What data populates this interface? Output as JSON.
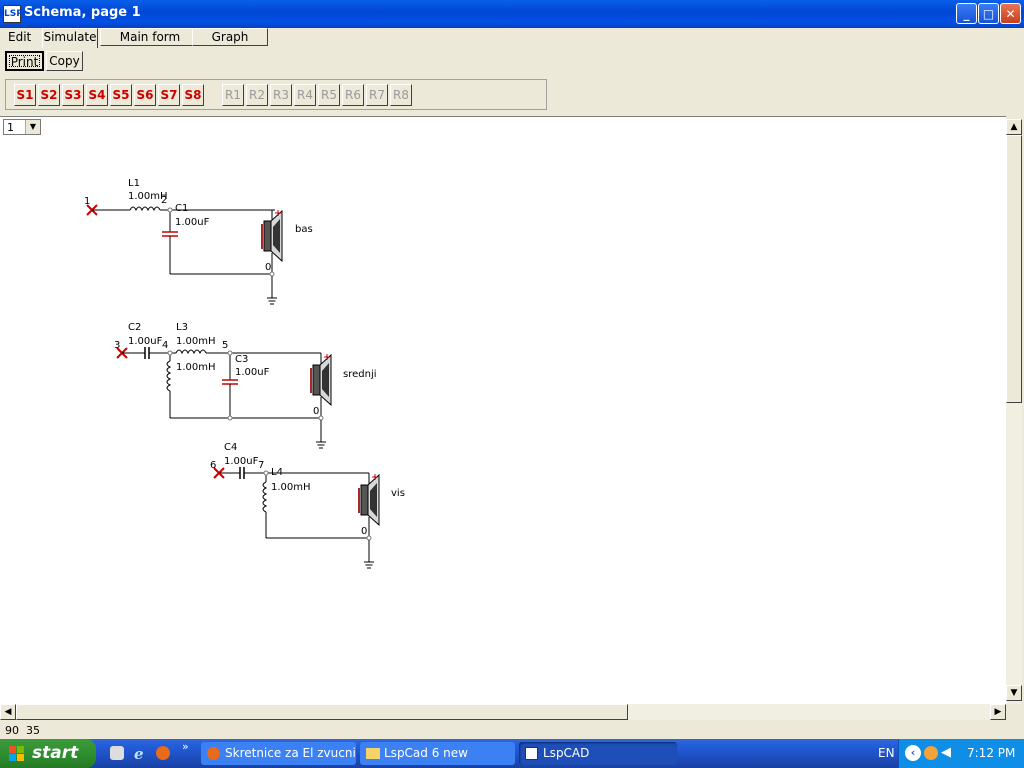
{
  "window": {
    "title": "Schema, page 1",
    "icon_text": "LSP",
    "controls": {
      "minimize": "_",
      "maximize": "□",
      "close": "✕"
    }
  },
  "menu": {
    "edit": "Edit",
    "simulate": "Simulate",
    "main_form": "Main form",
    "graph": "Graph"
  },
  "toolbar": {
    "print": "Print",
    "copy": "Copy"
  },
  "s_buttons": [
    "S1",
    "S2",
    "S3",
    "S4",
    "S5",
    "S6",
    "S7",
    "S8"
  ],
  "r_buttons": [
    "R1",
    "R2",
    "R3",
    "R4",
    "R5",
    "R6",
    "R7",
    "R8"
  ],
  "page_select": {
    "value": "1"
  },
  "schematic": {
    "bas": {
      "l1_name": "L1",
      "l1_value": "1.00mH",
      "node_in": "1",
      "node_mid": "2",
      "c1_name": "C1",
      "c1_value": "1.00uF",
      "ground_node": "0",
      "speaker": "bas"
    },
    "srednji": {
      "c2_name": "C2",
      "c2_value": "1.00uF",
      "l3_name": "L3",
      "l3_value": "1.00mH",
      "node_in": "3",
      "node_a": "4",
      "node_b": "5",
      "l2_value": "1.00mH",
      "c3_name": "C3",
      "c3_value": "1.00uF",
      "ground_node": "0",
      "speaker": "srednji"
    },
    "vis": {
      "c4_name": "C4",
      "c4_value": "1.00uF",
      "node_in": "6",
      "node_a": "7",
      "l4_name": "L4",
      "l4_value": "1.00mH",
      "ground_node": "0",
      "speaker": "vis"
    }
  },
  "status_bar": {
    "coords": "90  35"
  },
  "taskbar": {
    "start": "start",
    "tasks": [
      "Skretnice za El zvucni...",
      "LspCad 6 new",
      "LspCAD"
    ],
    "chevron": "»",
    "language": "EN",
    "time": "7:12 PM"
  },
  "colors": {
    "title_blue": "#0047d4",
    "red_marker": "#cc0000",
    "taskbar_blue": "#245edb",
    "start_green": "#2f8f2f"
  }
}
